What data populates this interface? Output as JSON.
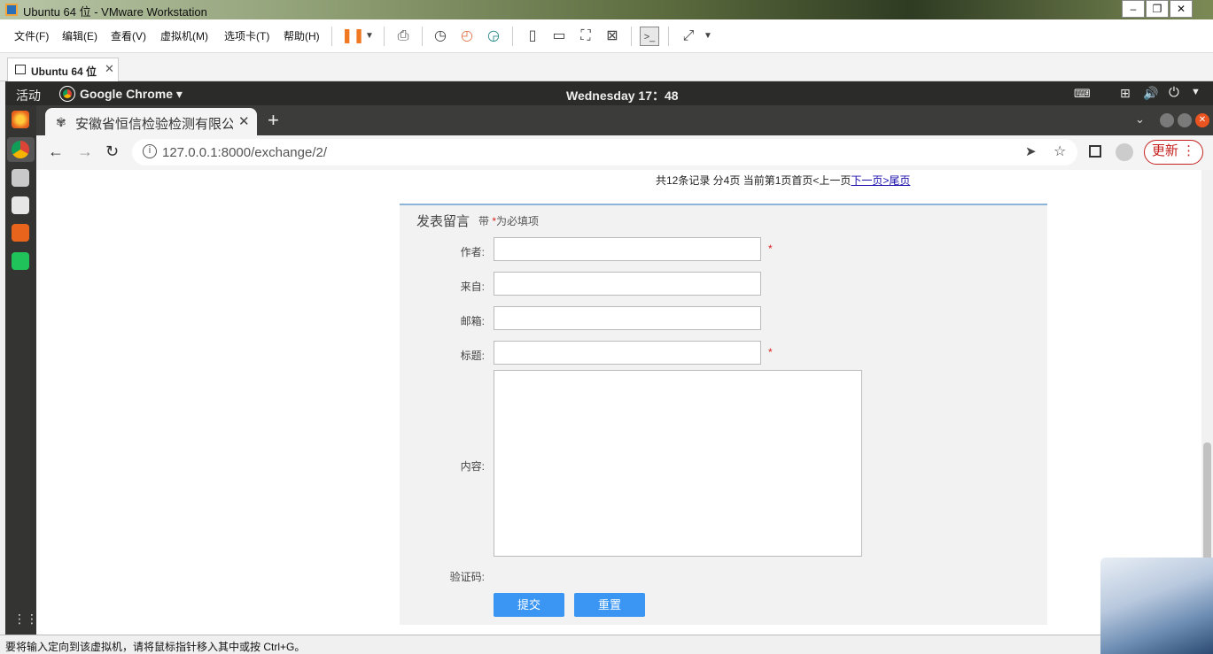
{
  "window": {
    "title": "Ubuntu 64 位 - VMware Workstation"
  },
  "vm_menu": {
    "items": [
      "文件(F)",
      "编辑(E)",
      "查看(V)",
      "虚拟机(M)",
      "选项卡(T)",
      "帮助(H)"
    ]
  },
  "vm_tab": {
    "label": "Ubuntu 64 位"
  },
  "ubuntu_bar": {
    "activities": "活动",
    "app_menu": "Google Chrome ▾",
    "clock": "Wednesday 17：48"
  },
  "chrome": {
    "tab_title": "安徽省恒信检验检测有限公司",
    "url": "127.0.0.1:8000/exchange/2/",
    "update_label": "更新"
  },
  "pager": {
    "summary": "共12条记录 分4页 当前第1页首页<上一页",
    "next": "下一页>",
    "last": "尾页"
  },
  "form": {
    "title": "发表留言",
    "note_prefix": "带",
    "note_star": "*",
    "note_suffix": "为必填项",
    "author_label": "作者:",
    "from_label": "来自:",
    "email_label": "邮箱:",
    "subject_label": "标题:",
    "content_label": "内容:",
    "captcha_label": "验证码:",
    "required_mark": "*",
    "submit_label": "提交",
    "reset_label": "重置"
  },
  "statusbar": {
    "text": "要将输入定向到该虚拟机，请将鼠标指针移入其中或按 Ctrl+G。"
  }
}
